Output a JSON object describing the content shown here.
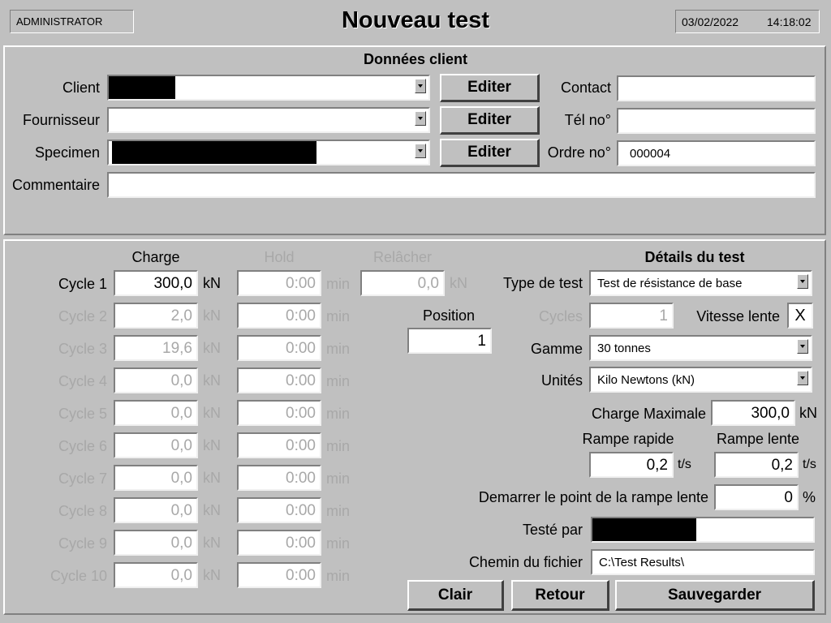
{
  "header": {
    "user": "ADMINISTRATOR",
    "title": "Nouveau test",
    "date": "03/02/2022",
    "time": "14:18:02"
  },
  "client_section": {
    "title": "Données client",
    "client_label": "Client",
    "supplier_label": "Fournisseur",
    "specimen_label": "Specimen",
    "comment_label": "Commentaire",
    "edit_label": "Editer",
    "contact_label": "Contact",
    "tel_label": "Tél no°",
    "order_label": "Ordre no°",
    "contact_value": "",
    "tel_value": "",
    "order_value": "000004",
    "comment_value": ""
  },
  "cycles": {
    "charge_header": "Charge",
    "hold_header": "Hold",
    "release_header": "Relâcher",
    "unit_kn": "kN",
    "unit_min": "min",
    "rows": [
      {
        "label": "Cycle 1",
        "charge": "300,0",
        "hold": "0:00",
        "release": "0,0"
      },
      {
        "label": "Cycle 2",
        "charge": "2,0",
        "hold": "0:00"
      },
      {
        "label": "Cycle 3",
        "charge": "19,6",
        "hold": "0:00"
      },
      {
        "label": "Cycle 4",
        "charge": "0,0",
        "hold": "0:00"
      },
      {
        "label": "Cycle 5",
        "charge": "0,0",
        "hold": "0:00"
      },
      {
        "label": "Cycle 6",
        "charge": "0,0",
        "hold": "0:00"
      },
      {
        "label": "Cycle 7",
        "charge": "0,0",
        "hold": "0:00"
      },
      {
        "label": "Cycle 8",
        "charge": "0,0",
        "hold": "0:00"
      },
      {
        "label": "Cycle 9",
        "charge": "0,0",
        "hold": "0:00"
      },
      {
        "label": "Cycle 10",
        "charge": "0,0",
        "hold": "0:00"
      }
    ],
    "position_label": "Position",
    "position_value": "1"
  },
  "details": {
    "title": "Détails du test",
    "test_type_label": "Type de test",
    "test_type_value": "Test de résistance de base",
    "cycles_label": "Cycles",
    "cycles_value": "1",
    "slow_speed_label": "Vitesse lente",
    "slow_speed_value": "X",
    "range_label": "Gamme",
    "range_value": "30 tonnes",
    "units_label": "Unités",
    "units_value": "Kilo Newtons (kN)",
    "max_load_label": "Charge Maximale",
    "max_load_value": "300,0",
    "max_load_unit": "kN",
    "fast_ramp_label": "Rampe rapide",
    "fast_ramp_value": "0,2",
    "slow_ramp_label": "Rampe lente",
    "slow_ramp_value": "0,2",
    "ramp_unit": "t/s",
    "start_slow_label": "Demarrer le point de la rampe lente",
    "start_slow_value": "0",
    "percent": "%",
    "tested_by_label": "Testé par",
    "file_path_label": "Chemin du fichier",
    "file_path_value": "C:\\Test Results\\"
  },
  "buttons": {
    "clear": "Clair",
    "back": "Retour",
    "save": "Sauvegarder"
  }
}
